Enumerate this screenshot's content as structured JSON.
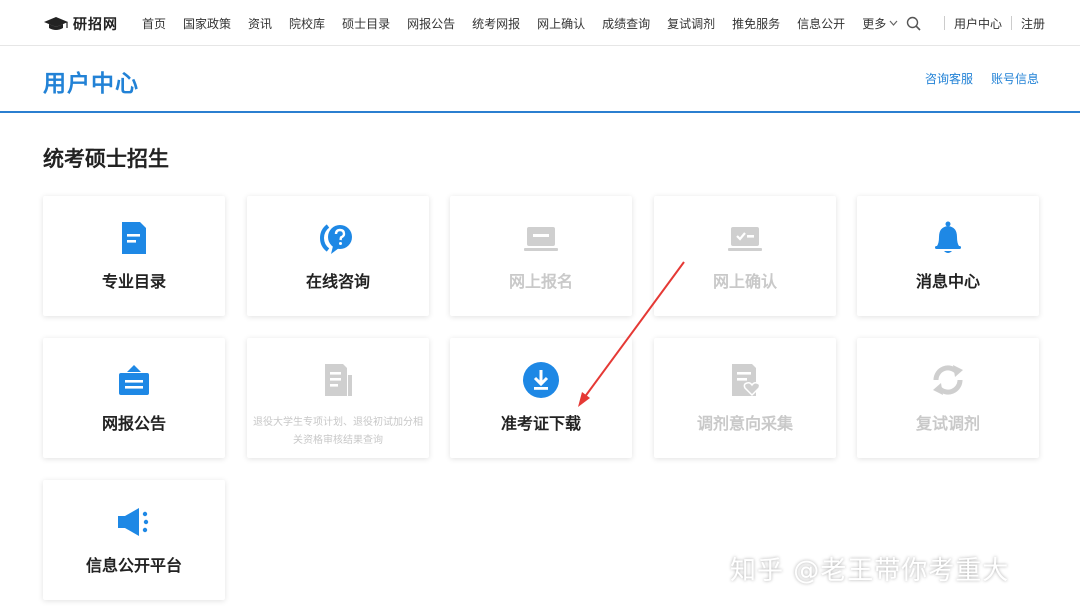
{
  "nav": {
    "logo_text": "研招网",
    "links": [
      "首页",
      "国家政策",
      "资讯",
      "院校库",
      "硕士目录",
      "网报公告",
      "统考网报",
      "网上确认",
      "成绩查询",
      "复试调剂",
      "推免服务",
      "信息公开"
    ],
    "more_label": "更多",
    "user_center": "用户中心",
    "register": "注册"
  },
  "header": {
    "title": "用户中心",
    "links": [
      "咨询客服",
      "账号信息"
    ]
  },
  "section": {
    "title": "统考硕士招生",
    "cards": [
      {
        "label": "专业目录",
        "icon": "document-icon",
        "enabled": true
      },
      {
        "label": "在线咨询",
        "icon": "question-chat-icon",
        "enabled": true
      },
      {
        "label": "网上报名",
        "icon": "laptop-icon",
        "enabled": false
      },
      {
        "label": "网上确认",
        "icon": "laptop-check-icon",
        "enabled": false
      },
      {
        "label": "消息中心",
        "icon": "bell-icon",
        "enabled": true
      },
      {
        "label": "网报公告",
        "icon": "briefcase-icon",
        "enabled": true
      },
      {
        "label": "退役大学生专项计划、退役初试加分相关资格审核结果查询",
        "icon": "list-document-icon",
        "enabled": false
      },
      {
        "label": "准考证下载",
        "icon": "download-icon",
        "enabled": true
      },
      {
        "label": "调剂意向采集",
        "icon": "heart-document-icon",
        "enabled": false
      },
      {
        "label": "复试调剂",
        "icon": "refresh-icon",
        "enabled": false
      },
      {
        "label": "信息公开平台",
        "icon": "megaphone-icon",
        "enabled": true
      }
    ]
  },
  "colors": {
    "accent": "#2282d6",
    "icon_blue": "#1e88e5",
    "disabled": "#cfcfcf",
    "annotation_arrow": "#e53935"
  },
  "watermark": "知乎 @老王带你考重大"
}
